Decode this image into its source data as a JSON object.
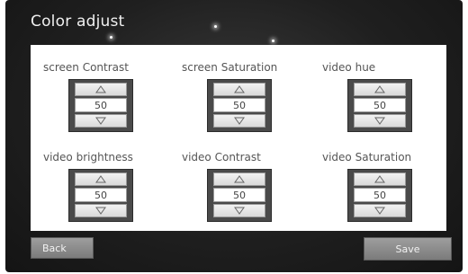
{
  "title": "Color adjust",
  "controls": [
    {
      "label": "screen Contrast",
      "value": "50"
    },
    {
      "label": "screen Saturation",
      "value": "50"
    },
    {
      "label": "video hue",
      "value": "50"
    },
    {
      "label": "video brightness",
      "value": "50"
    },
    {
      "label": "video Contrast",
      "value": "50"
    },
    {
      "label": "video Saturation",
      "value": "50"
    }
  ],
  "buttons": {
    "back": "Back",
    "save": "Save"
  },
  "icons": {
    "increment": "triangle-up-icon",
    "decrement": "triangle-down-icon"
  },
  "colors": {
    "background": "#1f1f1f",
    "panel": "#ffffff",
    "button": "#8a8a8a"
  }
}
